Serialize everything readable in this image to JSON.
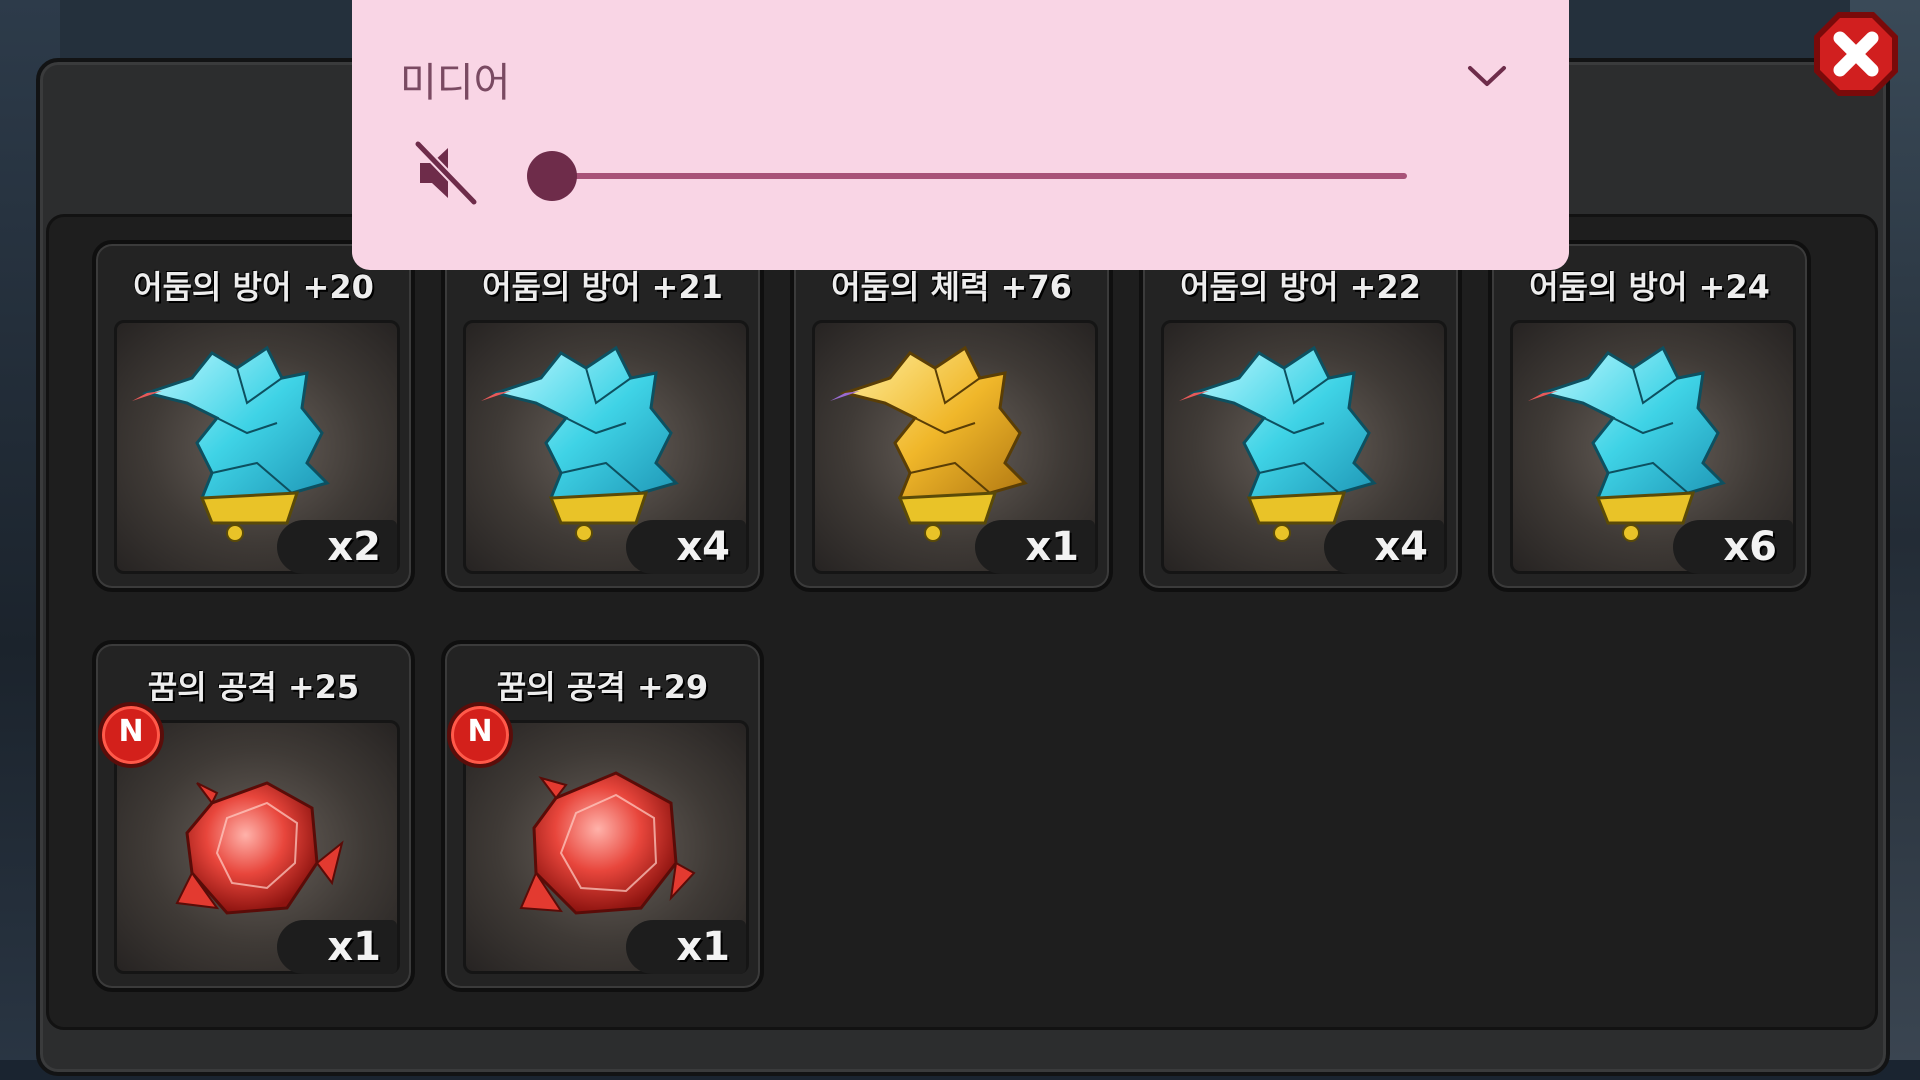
{
  "media": {
    "title": "미디어",
    "volume": 0,
    "muted": true,
    "accent_color": "#6e2c4a",
    "icons": {
      "expand": "chevron-down-icon",
      "mute": "volume-mute-icon"
    }
  },
  "close_button": {
    "icon": "close-icon",
    "color": "#d11f1f"
  },
  "items": [
    {
      "title": "어둠의 방어 +20",
      "qty": "x2",
      "icon": "cyan-crystal-tail-icon",
      "new": false
    },
    {
      "title": "어둠의 방어 +21",
      "qty": "x4",
      "icon": "cyan-crystal-tail-icon",
      "new": false
    },
    {
      "title": "어둠의 체력 +76",
      "qty": "x1",
      "icon": "gold-crystal-tail-icon",
      "new": false
    },
    {
      "title": "어둠의 방어 +22",
      "qty": "x4",
      "icon": "cyan-crystal-tail-icon",
      "new": false
    },
    {
      "title": "어둠의 방어 +24",
      "qty": "x6",
      "icon": "cyan-crystal-tail-icon",
      "new": false
    },
    {
      "title": "꿈의 공격 +25",
      "qty": "x1",
      "icon": "red-gem-icon",
      "new": true,
      "badge": "N"
    },
    {
      "title": "꿈의 공격 +29",
      "qty": "x1",
      "icon": "red-gem-icon",
      "new": true,
      "badge": "N"
    }
  ]
}
